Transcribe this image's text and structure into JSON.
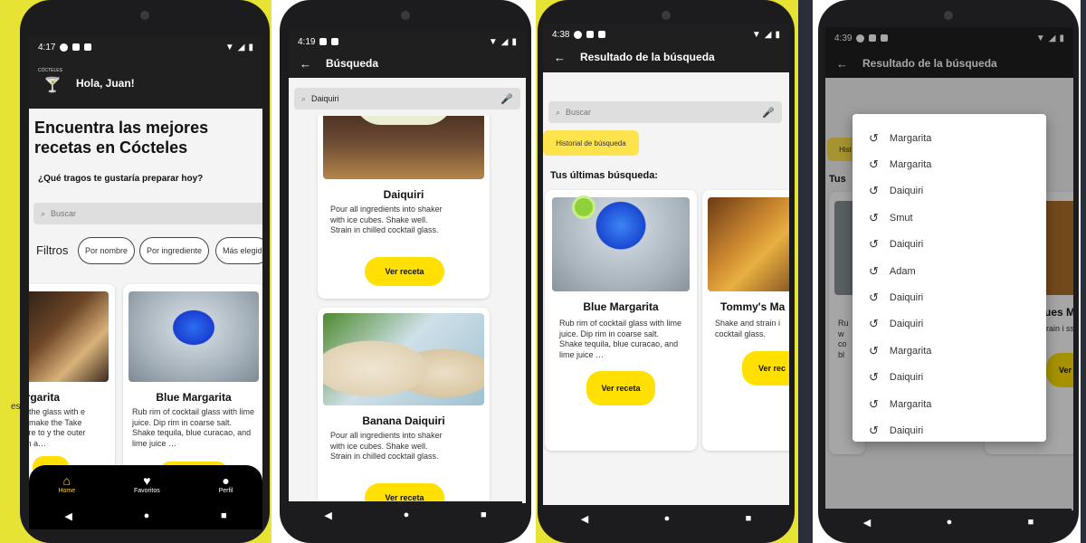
{
  "colors": {
    "accent": "#ffe000",
    "frame": "#e6e335",
    "appbar": "#1f1f1f"
  },
  "screen1": {
    "time": "4:17",
    "greeting": "Hola, Juan!",
    "logo_text": "CÓCTELES",
    "headline": "Encuentra las mejores recetas en Cócteles",
    "question": "¿Qué tragos te gustaría preparar hoy?",
    "search_placeholder": "Buscar",
    "filters_label": "Filtros",
    "chips": [
      "Por nombre",
      "Por ingrediente",
      "Más elegid"
    ],
    "cards": [
      {
        "title": "argarita",
        "desc": "of the glass with e to make the Take care to y the outer rim a…"
      },
      {
        "title": "Blue Margarita",
        "desc": "Rub rim of cocktail glass with lime juice. Dip rim in coarse salt. Shake tequila, blue curacao, and lime juice …"
      }
    ],
    "nav": [
      {
        "label": "Home",
        "icon": "home-icon"
      },
      {
        "label": "Favoritos",
        "icon": "heart-icon"
      },
      {
        "label": "Perfil",
        "icon": "person-icon"
      }
    ],
    "side_text": "es"
  },
  "screen2": {
    "time": "4:19",
    "title": "Búsqueda",
    "search_value": "Daiquiri",
    "cards": [
      {
        "title": "Daiquiri",
        "desc": "Pour all ingredients into shaker with ice cubes. Shake well. Strain in chilled cocktail glass.",
        "button": "Ver receta"
      },
      {
        "title": "Banana Daiquiri",
        "desc": "Pour all ingredients into shaker with ice cubes. Shake well. Strain in chilled cocktail glass.",
        "button": "Ver receta"
      }
    ]
  },
  "screen3": {
    "time": "4:38",
    "title": "Resultado de la búsqueda",
    "search_placeholder": "Buscar",
    "history_chip": "Historial de búsqueda",
    "section": "Tus últimas búsqueda:",
    "cards": [
      {
        "title": "Blue Margarita",
        "desc": "Rub rim of cocktail glass with lime juice. Dip rim in coarse salt. Shake tequila, blue curacao, and lime juice …",
        "button": "Ver receta"
      },
      {
        "title": "Tommy's Ma",
        "desc": "Shake and strain i cocktail glass.",
        "button": "Ver rec"
      }
    ]
  },
  "screen4": {
    "time": "4:39",
    "title": "Resultado de la búsqueda",
    "history": [
      "Margarita",
      "Margarita",
      "Daiquiri",
      "Smut",
      "Daiquiri",
      "Adam",
      "Daiquiri",
      "Daiquiri",
      "Margarita",
      "Daiquiri",
      "Margarita",
      "Daiquiri"
    ],
    "bg_chip": "Hist",
    "bg_section": "Tus",
    "bg_card_title": "ues Ma",
    "bg_card_text": "Ru w co bl",
    "bg_card_text2": "rain i ss.",
    "bg_btn": "Ver"
  }
}
